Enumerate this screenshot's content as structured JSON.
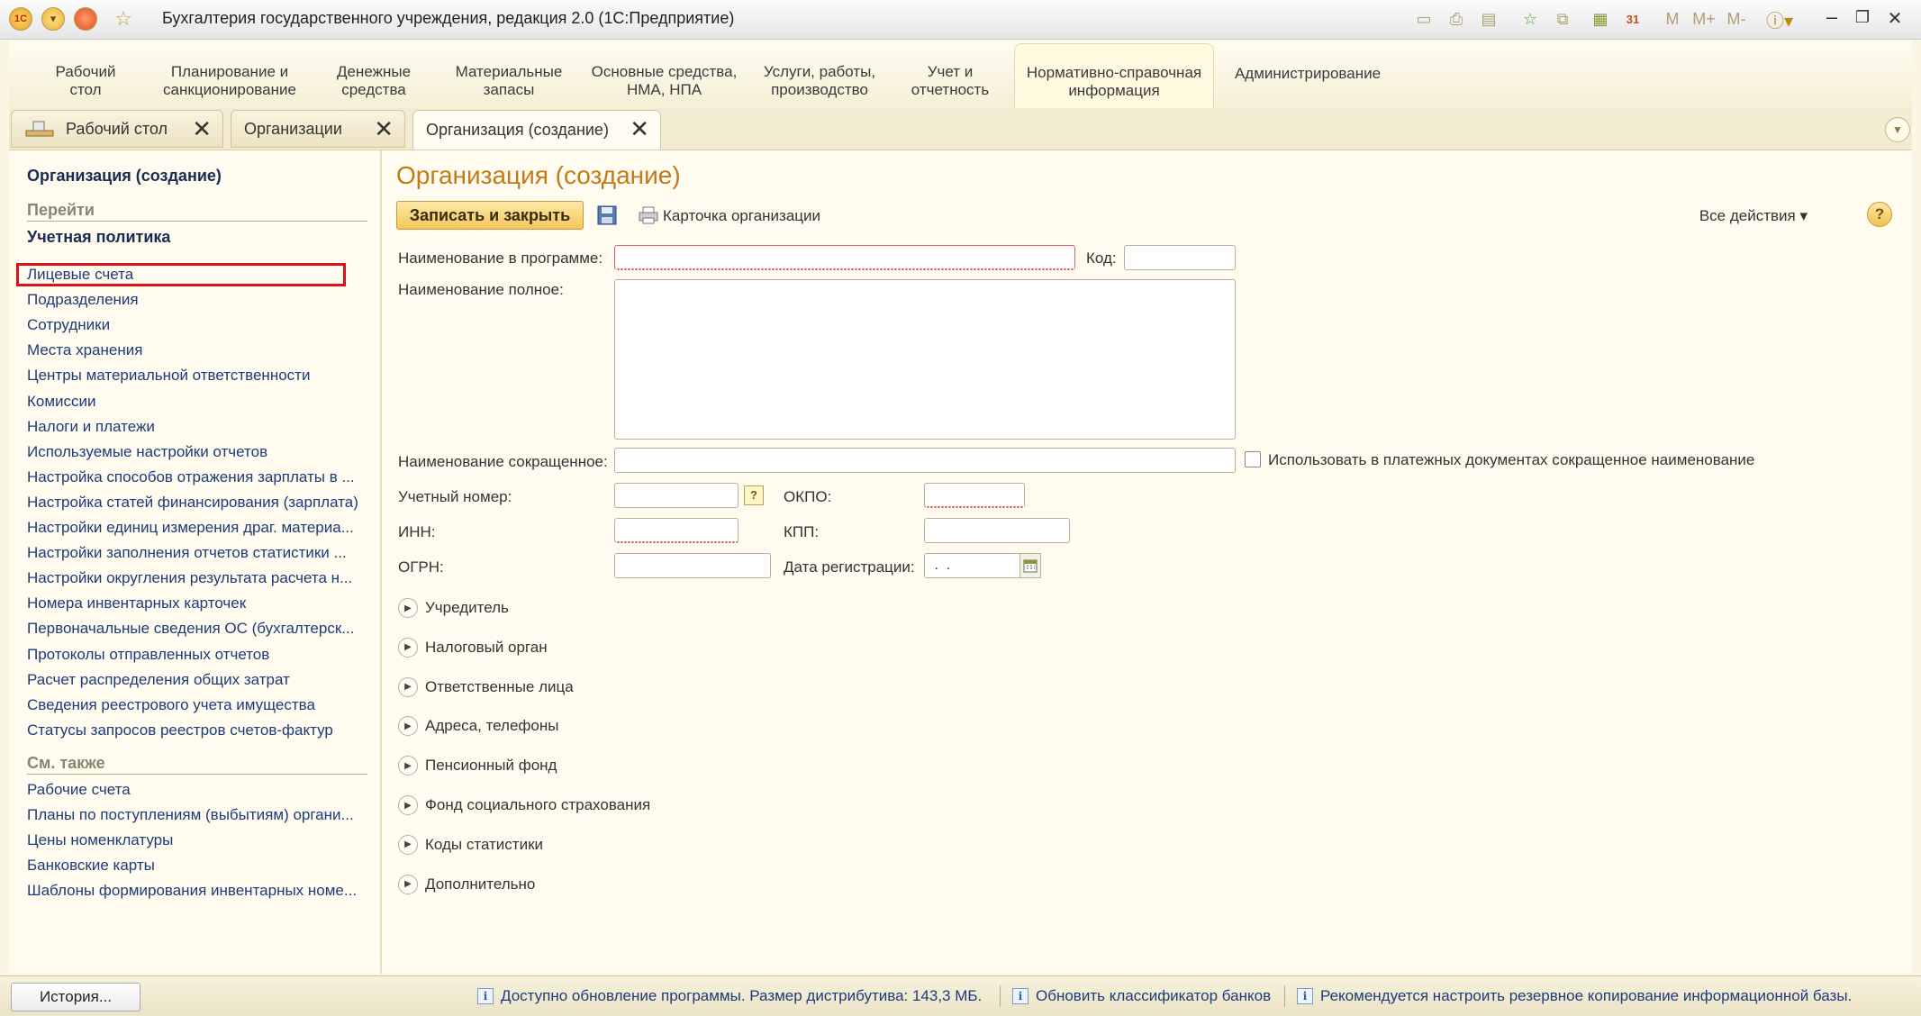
{
  "window": {
    "title": "Бухгалтерия государственного учреждения, редакция 2.0  (1С:Предприятие)",
    "logo_text": "1С",
    "toolbar_m": "M",
    "toolbar_mplus": "M+",
    "toolbar_mminus": "M-",
    "calendar_text": "31",
    "minimize": "–",
    "restore": "❐",
    "close": "✕"
  },
  "sections": [
    {
      "label": "Рабочий\nстол"
    },
    {
      "label": "Планирование и\nсанкционирование"
    },
    {
      "label": "Денежные\nсредства"
    },
    {
      "label": "Материальные\nзапасы"
    },
    {
      "label": "Основные средства,\nНМА, НПА"
    },
    {
      "label": "Услуги, работы,\nпроизводство"
    },
    {
      "label": "Учет и\nотчетность"
    },
    {
      "label": "Нормативно-справочная\nинформация"
    },
    {
      "label": "Администрирование"
    }
  ],
  "tabs": [
    {
      "label": "Рабочий стол",
      "close": "✕"
    },
    {
      "label": "Организации",
      "close": "✕"
    },
    {
      "label": "Организация (создание)",
      "close": "✕"
    }
  ],
  "nav": {
    "title": "Организация (создание)",
    "go_group": "Перейти",
    "policy": "Учетная политика",
    "links": [
      "Лицевые счета",
      "Подразделения",
      "Сотрудники",
      "Места хранения",
      "Центры материальной ответственности",
      "Комиссии",
      "Налоги и платежи",
      "Используемые настройки отчетов",
      "Настройка способов отражения зарплаты в ...",
      "Настройка статей финансирования (зарплата)",
      "Настройки единиц измерения драг. материа...",
      "Настройки заполнения отчетов статистики ...",
      "Настройки округления результата расчета н...",
      "Номера инвентарных карточек",
      "Первоначальные сведения ОС (бухгалтерск...",
      "Протоколы отправленных отчетов",
      "Расчет распределения общих затрат",
      "Сведения реестрового учета имущества",
      "Статусы запросов реестров счетов-фактур"
    ],
    "see_also_group": "См. также",
    "see_also": [
      "Рабочие счета",
      "Планы по поступлениям (выбытиям) органи...",
      "Цены номенклатуры",
      "Банковские карты",
      "Шаблоны формирования инвентарных номе..."
    ]
  },
  "form": {
    "title": "Организация (создание)",
    "save_close": "Записать и закрыть",
    "card": "Карточка организации",
    "all_actions": "Все действия ▾",
    "help": "?",
    "fields": {
      "name_program": {
        "label": "Наименование в программе:",
        "value": ""
      },
      "code": {
        "label": "Код:",
        "value": ""
      },
      "name_full": {
        "label": "Наименование полное:",
        "value": ""
      },
      "name_short": {
        "label": "Наименование сокращенное:",
        "value": ""
      },
      "use_short_in_payments": {
        "label": "Использовать в платежных документах сокращенное наименование",
        "checked": false
      },
      "reg_number": {
        "label": "Учетный номер:",
        "value": ""
      },
      "reg_help": "?",
      "okpo": {
        "label": "ОКПО:",
        "value": ""
      },
      "inn": {
        "label": "ИНН:",
        "value": ""
      },
      "kpp": {
        "label": "КПП:",
        "value": ""
      },
      "ogrn": {
        "label": "ОГРН:",
        "value": ""
      },
      "reg_date": {
        "label": "Дата регистрации:",
        "value": " .  ."
      }
    },
    "groups": [
      "Учредитель",
      "Налоговый орган",
      "Ответственные лица",
      "Адреса, телефоны",
      "Пенсионный фонд",
      "Фонд социального страхования",
      "Коды статистики",
      "Дополнительно"
    ]
  },
  "status": {
    "history": "История...",
    "messages": [
      "Доступно обновление программы. Размер дистрибутива: 143,3 МБ.",
      "Обновить классификатор банков",
      "Рекомендуется настроить резервное копирование информационной базы."
    ]
  }
}
